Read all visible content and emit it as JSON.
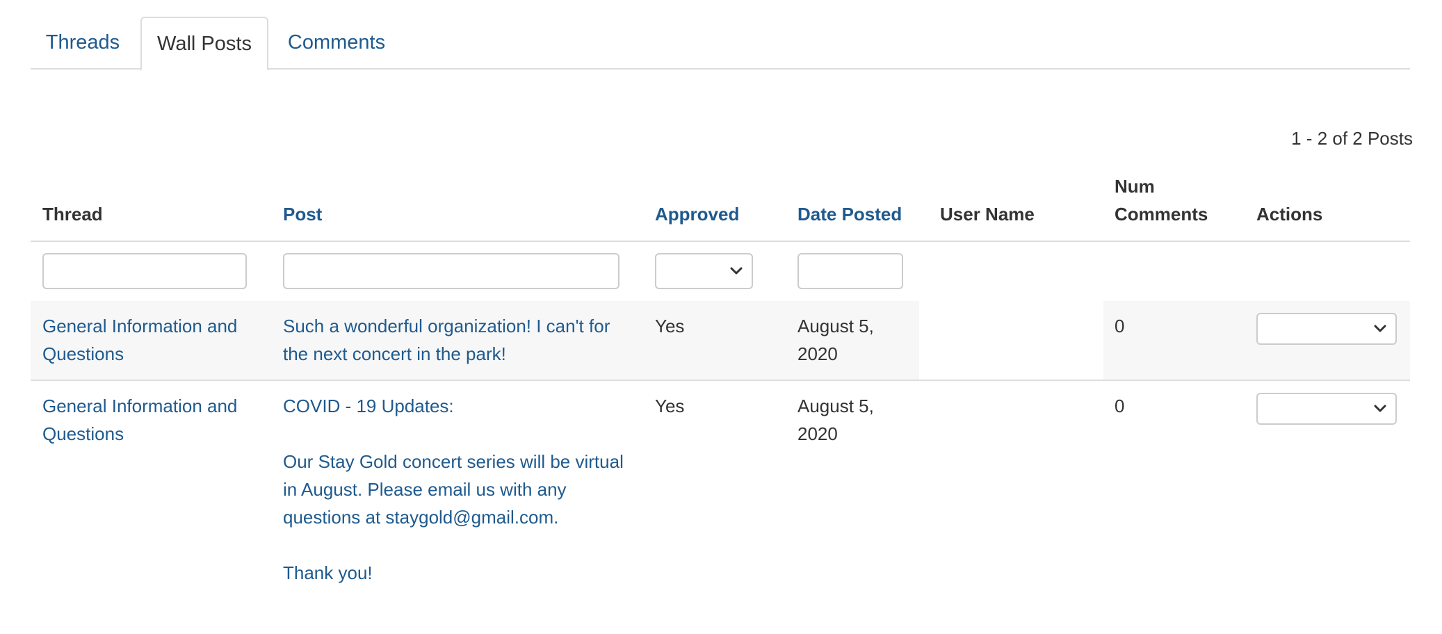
{
  "tabs": [
    {
      "label": "Threads",
      "active": false
    },
    {
      "label": "Wall Posts",
      "active": true
    },
    {
      "label": "Comments",
      "active": false
    }
  ],
  "pagination": {
    "summary": "1 - 2 of 2 Posts"
  },
  "columns": {
    "thread": "Thread",
    "post": "Post",
    "approved": "Approved",
    "date_posted": "Date Posted",
    "user_name": "User Name",
    "num_comments_line1": "Num",
    "num_comments_line2": "Comments",
    "actions": "Actions"
  },
  "filters": {
    "thread": "",
    "post": "",
    "approved": "",
    "date_posted": ""
  },
  "rows": [
    {
      "thread_line1": "General Information and",
      "thread_line2": "Questions",
      "post_line1": "Such a wonderful organization! I can't for",
      "post_line2": "the next concert in the park!",
      "approved": "Yes",
      "date_line1": "August 5,",
      "date_line2": "2020",
      "user_name": "",
      "num_comments": "0",
      "action": ""
    },
    {
      "thread_line1": "General Information and",
      "thread_line2": "Questions",
      "post_line1": "COVID - 19 Updates:",
      "post_line2": "Our Stay Gold concert series will be virtual",
      "post_line3": "in August. Please email us with any",
      "post_line4": "questions at staygold@gmail.com.",
      "post_line5": "Thank you!",
      "approved": "Yes",
      "date_line1": "August 5,",
      "date_line2": "2020",
      "user_name": "",
      "num_comments": "0",
      "action": ""
    }
  ],
  "colors": {
    "link": "#1f5a8e",
    "text": "#333333",
    "stripe": "#f7f7f7",
    "border": "#dddddd"
  },
  "icons": {
    "dropdown": "chevron-down-icon"
  }
}
